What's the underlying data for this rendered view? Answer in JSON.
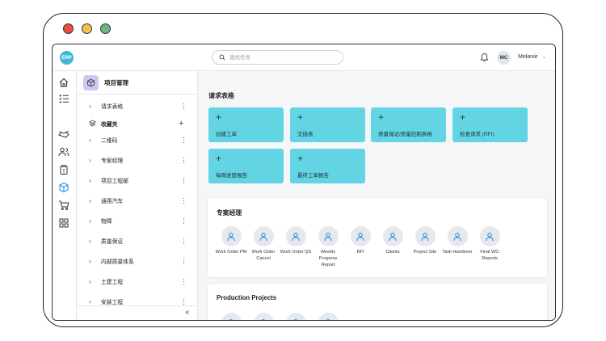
{
  "app": {
    "logo_text": "ERP",
    "search_placeholder": "查找任务",
    "user_initials": "MC",
    "user_name": "Melanie"
  },
  "rail_icons": [
    "home-icon",
    "task-list-icon",
    "handshake-icon",
    "users-icon",
    "clipboard-icon",
    "cube-icon",
    "cart-icon",
    "grid-icon"
  ],
  "panel": {
    "title": "项目管理",
    "items": [
      {
        "label": "请求表格",
        "type": "item"
      },
      {
        "label": "收藏夹",
        "type": "favorites"
      },
      {
        "label": "二维码",
        "type": "item"
      },
      {
        "label": "专案经理",
        "type": "item"
      },
      {
        "label": "项目工程部",
        "type": "item"
      },
      {
        "label": "通用汽车",
        "type": "item"
      },
      {
        "label": "物障",
        "type": "item"
      },
      {
        "label": "质量保证",
        "type": "item"
      },
      {
        "label": "内部质量体系",
        "type": "item"
      },
      {
        "label": "土建工程",
        "type": "item"
      },
      {
        "label": "安装工程",
        "type": "item"
      }
    ],
    "collapse_glyph": "«"
  },
  "main": {
    "request_forms_title": "请求表格",
    "tiles": [
      {
        "label": "创建工单"
      },
      {
        "label": "交接表"
      },
      {
        "label": "质量保证/质量控制表格"
      },
      {
        "label": "检查请求 (RFI)"
      },
      {
        "label": "每周进度报告"
      },
      {
        "label": "最终工单报告"
      }
    ],
    "pm_card": {
      "title": "专案经理",
      "chips": [
        "Work Order PM",
        "Work Order Cancel",
        "Work Order QS",
        "Weekly Progress Report",
        "RFI",
        "Clients",
        "Project Site",
        "Task Handover",
        "Final WO Reports"
      ]
    },
    "prod_card": {
      "title": "Production Projects"
    }
  },
  "colors": {
    "tile": "#63d4e3",
    "logo": "#3fb8d8",
    "panel_icon_bg": "#cfc7ef",
    "chip_icon": "#2f8fe0"
  }
}
